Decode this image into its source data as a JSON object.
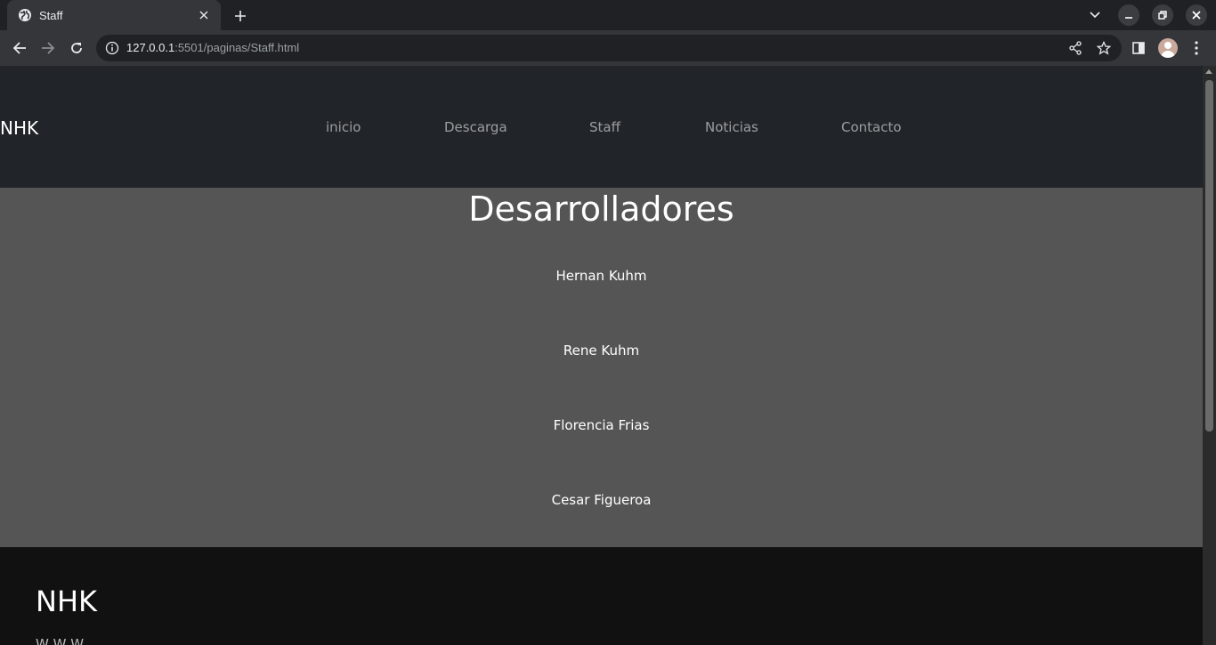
{
  "browser": {
    "tab_title": "Staff",
    "url_host": "127.0.0.1",
    "url_rest": ":5501/paginas/Staff.html"
  },
  "site": {
    "brand": "NHK",
    "nav": [
      "inicio",
      "Descarga",
      "Staff",
      "Noticias",
      "Contacto"
    ],
    "heading": "Desarrolladores",
    "developers": [
      "Hernan Kuhm",
      "Rene Kuhm",
      "Florencia Frias",
      "Cesar Figueroa"
    ],
    "footer_brand": "NHK",
    "footer_sub": "W W W"
  },
  "colors": {
    "header_bg": "#212529",
    "main_bg": "#555555",
    "footer_bg": "#111111"
  }
}
